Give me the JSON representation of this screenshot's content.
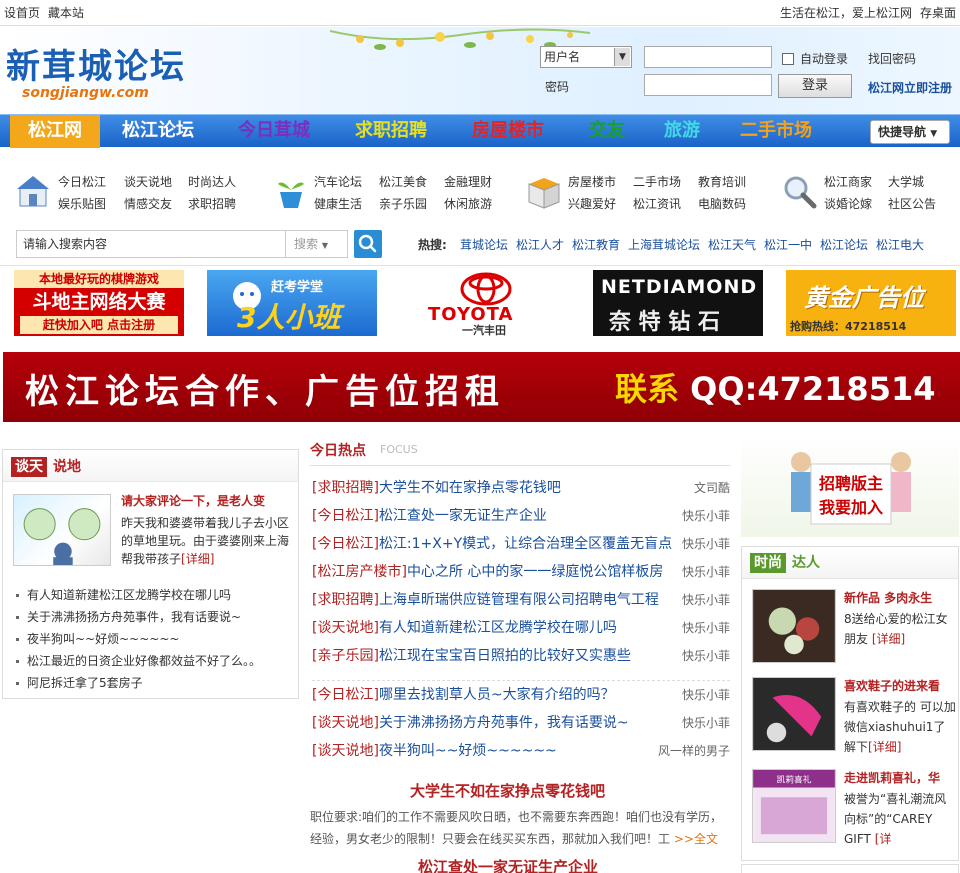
{
  "topbar": {
    "home": "设首页",
    "fav": "藏本站",
    "slogan": "生活在松江，爱上松江网",
    "desktop": "存桌面"
  },
  "header": {
    "logo_text": "新茸城论坛",
    "logo_domain": "songjiangw.com",
    "login": {
      "user_select": "用户名",
      "password_label": "密码",
      "auto_login": "自动登录",
      "find_password": "找回密码",
      "login_button": "登录",
      "register": "松江网立即注册"
    }
  },
  "nav": {
    "items": [
      {
        "label": "松江网",
        "color": "#ffffff"
      },
      {
        "label": "松江论坛",
        "color": "#ffffff"
      },
      {
        "label": "今日茸城",
        "color": "#7a2fbf"
      },
      {
        "label": "求职招聘",
        "color": "#e5e022"
      },
      {
        "label": "房屋楼市",
        "color": "#e0242a"
      },
      {
        "label": "交友",
        "color": "#18a02a"
      },
      {
        "label": "旅游",
        "color": "#44d7e8"
      },
      {
        "label": "二手市场",
        "color": "#f6a11b"
      }
    ],
    "quick": "快捷导航",
    "active_color": "#f3a81c"
  },
  "categories": {
    "groups": [
      {
        "icon": "house-icon",
        "links": [
          "今日松江",
          "谈天说地",
          "时尚达人",
          "娱乐贴图",
          "情感交友",
          "求职招聘"
        ]
      },
      {
        "icon": "plant-pot-icon",
        "links": [
          "汽车论坛",
          "松江美食",
          "金融理财",
          "健康生活",
          "亲子乐园",
          "休闲旅游"
        ]
      },
      {
        "icon": "box-icon",
        "links": [
          "房屋楼市",
          "二手市场",
          "教育培训",
          "兴趣爱好",
          "松江资讯",
          "电脑数码"
        ]
      },
      {
        "icon": "magnifier-icon",
        "links": [
          "松江商家",
          "大学城",
          "谈婚论嫁",
          "社区公告"
        ]
      }
    ],
    "search": {
      "placeholder": "请输入搜索内容",
      "type": "搜索"
    },
    "hot_label": "热搜:",
    "hot": [
      "茸城论坛",
      "松江人才",
      "松江教育",
      "上海茸城论坛",
      "松江天气",
      "松江一中",
      "松江论坛",
      "松江电大"
    ]
  },
  "ads": [
    {
      "line1": "本地最好玩的棋牌游戏",
      "line2": "斗地主网络大赛",
      "line3": "赶快加入吧 点击注册"
    },
    {
      "line1": "赶考学堂",
      "line2": "3人小班"
    },
    {
      "line1": "TOYOTA",
      "line2": "一汽丰田"
    },
    {
      "line1": "NETDIAMOND",
      "line2": "奈 特 钻 石"
    },
    {
      "line1": "黄金广告位",
      "line2": "抢购热线：47218514"
    }
  ],
  "banner": {
    "left": "松江论坛合作、广告位招租",
    "right_a": "联系",
    "right_b": "QQ:47218514"
  },
  "left": {
    "tag": "谈天",
    "title": "说地",
    "featured_title": "请大家评论一下，是老人变",
    "featured_desc": "昨天我和婆婆带着我儿子去小区的草地里玩。由于婆婆刚来上海帮我带孩子",
    "more": "[详细]",
    "list": [
      "有人知道新建松江区龙腾学校在哪儿吗",
      "关于沸沸扬扬方舟苑事件，我有话要说~",
      "夜半狗叫~~好烦~~~~~~",
      "松江最近的日资企业好像都效益不好了么。。",
      "阿尼拆迁拿了5套房子"
    ]
  },
  "middle": {
    "title": "今日热点",
    "focus": "FOCUS",
    "rows": [
      {
        "cat": "[求职招聘]",
        "title": "大学生不如在家挣点零花钱吧",
        "author": "文司酷"
      },
      {
        "cat": "[今日松江]",
        "title": "松江查处一家无证生产企业",
        "author": "快乐小菲"
      },
      {
        "cat": "[今日松江]",
        "title": "松江:1+X+Y模式，让综合治理全区覆盖无盲点",
        "author": "快乐小菲"
      },
      {
        "cat": "[松江房产楼市]",
        "title": "中心之所 心中的家一一绿庭悦公馆样板房",
        "author": "快乐小菲"
      },
      {
        "cat": "[求职招聘]",
        "title": "上海卓昕瑞供应链管理有限公司招聘电气工程",
        "author": "快乐小菲"
      },
      {
        "cat": "[谈天说地]",
        "title": "有人知道新建松江区龙腾学校在哪儿吗",
        "author": "快乐小菲"
      },
      {
        "cat": "[亲子乐园]",
        "title": "松江现在宝宝百日照拍的比较好又实惠些",
        "author": "快乐小菲"
      },
      {
        "cat": "[今日松江]",
        "title": "哪里去找割草人员~大家有介绍的吗？",
        "author": "快乐小菲"
      },
      {
        "cat": "[谈天说地]",
        "title": "关于沸沸扬扬方舟苑事件，我有话要说~",
        "author": "快乐小菲"
      },
      {
        "cat": "[谈天说地]",
        "title": "夜半狗叫~~好烦~~~~~~",
        "author": "风一样的男子"
      }
    ],
    "feature1_title": "大学生不如在家挣点零花钱吧",
    "feature1_desc": "职位要求:咱们的工作不需要风吹日晒，也不需要东奔西跑！咱们也没有学历，经验，男女老少的限制！只要会在线买买东西，那就加入我们吧！工",
    "feature1_more": ">>全文",
    "feature2_title": "松江查处一家无证生产企业"
  },
  "right": {
    "ad_line1": "招聘版主",
    "ad_line2": "我要加入",
    "tag": "时尚",
    "title": "达人",
    "items": [
      {
        "title": "新作品 多肉永生",
        "desc": "8送给心爱的松江女朋友",
        "more": "[详细]"
      },
      {
        "title": "喜欢鞋子的进来看",
        "desc": "有喜欢鞋子的 可以加 微信xiashuhui1了解下",
        "more": "[详细]"
      },
      {
        "title": "走进凯莉喜礼，华",
        "desc": "被誉为“喜礼潮流风向标”的“CAREY GIFT",
        "more": "[详"
      }
    ],
    "item3_logo": "凯莉喜礼"
  }
}
